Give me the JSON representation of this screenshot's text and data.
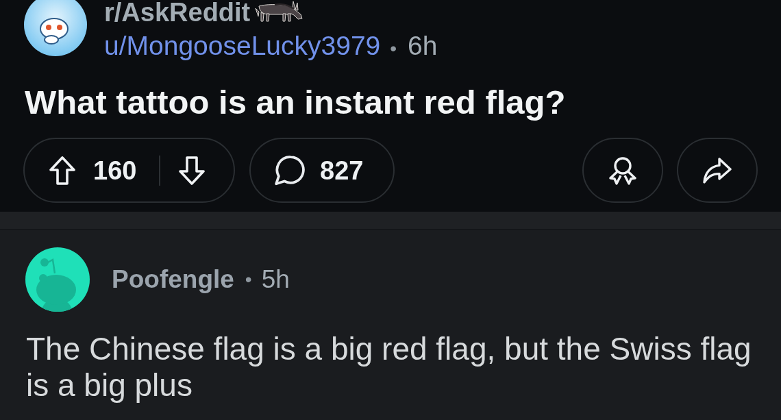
{
  "post": {
    "subreddit": "r/AskReddit",
    "author": "u/MongooseLucky3979",
    "separator": "•",
    "age": "6h",
    "title": "What tattoo is an instant red flag?",
    "score": "160",
    "comment_count": "827"
  },
  "comments": [
    {
      "author": "Poofengle",
      "separator": "•",
      "age": "5h",
      "body": "The Chinese flag is a big red flag, but the Swiss flag is a big plus"
    }
  ]
}
